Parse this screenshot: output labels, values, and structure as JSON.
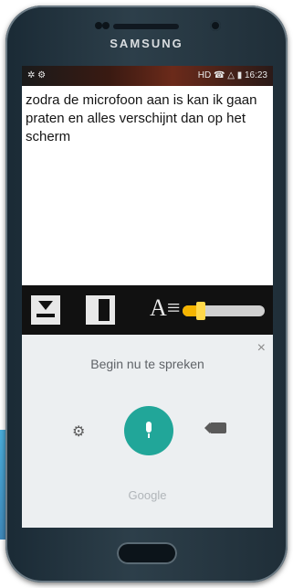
{
  "device": {
    "brand": "SAMSUNG"
  },
  "status_bar": {
    "left_icons": "✲ ⚙",
    "right_text": "HD ☎ △ ▮ 16:23"
  },
  "editor": {
    "text": "zodra de microfoon aan is kan ik gaan praten en alles verschijnt dan op het scherm"
  },
  "toolbar": {
    "font_size_level": 0.22
  },
  "voice_input": {
    "prompt": "Begin nu te spreken",
    "close_label": "×",
    "footer": "Google"
  },
  "icons": {
    "save": "download-icon",
    "layout": "panel-icon",
    "font": "font-size-icon",
    "settings": "gear-icon",
    "mic": "microphone-icon",
    "backspace": "backspace-icon",
    "close": "close-icon"
  },
  "colors": {
    "mic_button": "#21a699",
    "slider_fill": "#f5b400",
    "voice_panel_bg": "#eceff1"
  }
}
